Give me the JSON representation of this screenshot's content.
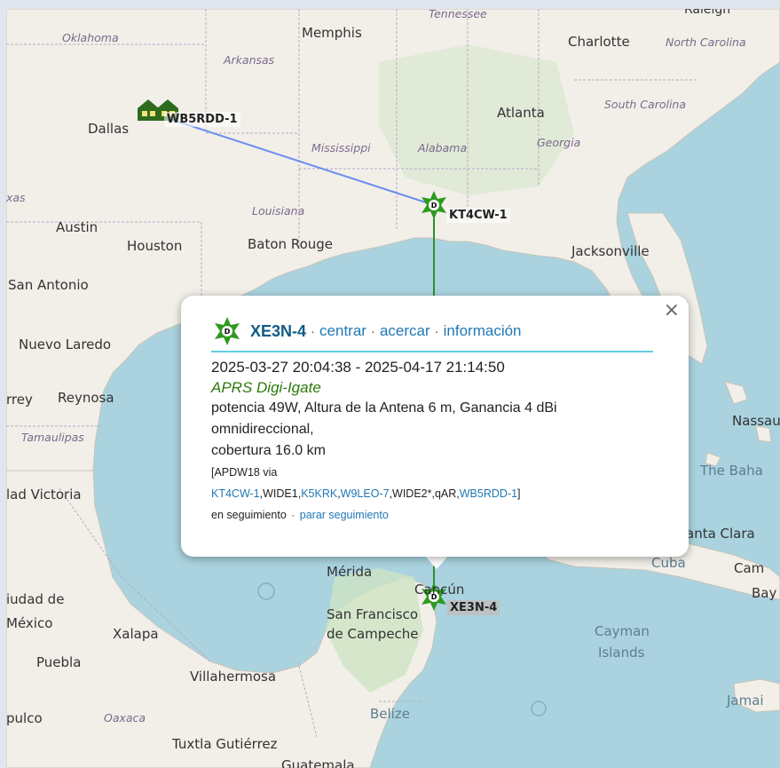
{
  "colors": {
    "water": "#aad3df",
    "land": "#f2efe9",
    "route_blue": "#6b8ff0",
    "route_green": "#2f8f2f",
    "station_green": "#2e9a1e",
    "popup_accent": "#5fd1de"
  },
  "map": {
    "labels": {
      "tennessee": "Tennessee",
      "raleigh": "Raleigh",
      "oklahoma": "Oklahoma",
      "memphis": "Memphis",
      "charlotte": "Charlotte",
      "north_carolina": "North Carolina",
      "arkansas": "Arkansas",
      "south_carolina": "South Carolina",
      "atlanta": "Atlanta",
      "dallas": "Dallas",
      "mississippi": "Mississippi",
      "alabama": "Alabama",
      "georgia": "Georgia",
      "texas": "xas",
      "louisiana": "Louisiana",
      "austin": "Austin",
      "houston": "Houston",
      "baton_rouge": "Baton Rouge",
      "jacksonville": "Jacksonville",
      "san_antonio": "San Antonio",
      "nuevo_laredo": "Nuevo Laredo",
      "monterrey": "rrey",
      "reynosa": "Reynosa",
      "tamaulipas": "Tamaulipas",
      "victoria": "lad Victoria",
      "nassau": "Nassau",
      "bahamas": "The Baha",
      "santa_clara": "anta Clara",
      "cuba": "Cuba",
      "camaguey": "Cam",
      "bayamo": "Bay",
      "merida": "Mérida",
      "cancun": "Cancún",
      "ciudad_mexico": "iudad de",
      "mexico": "México",
      "xalapa": "Xalapa",
      "san_francisco": "San Francisco",
      "campeche": "de Campeche",
      "cayman": "Cayman",
      "islands": "Islands",
      "puebla": "Puebla",
      "villahermosa": "Villahermosa",
      "jamaica": "Jamai",
      "acapulco": "pulco",
      "oaxaca": "Oaxaca",
      "belize": "Belize",
      "tuxtla": "Tuxtla Gutiérrez",
      "guatemala": "Guatemala"
    },
    "stations": {
      "wb5rdd": "WB5RDD-1",
      "kt4cw": "KT4CW-1",
      "xe3n": "XE3N-4"
    }
  },
  "popup": {
    "callsign": "XE3N-4",
    "sep": "·",
    "link_center": "centrar",
    "link_zoom": "acercar",
    "link_info": "información",
    "close": "×",
    "time_range": "2025-03-27 20:04:38 - 2025-04-17 21:14:50",
    "type": "APRS Digi-Igate",
    "phg_line": "potencia 49W, Altura de la Antena 6 m, Ganancia 4 dBi",
    "pattern": "omnidireccional,",
    "coverage": "cobertura 16.0 km",
    "path_prefix": "[APDW18 via",
    "path_1": "KT4CW-1",
    "path_2": ",WIDE1,",
    "path_3": "K5KRK",
    "path_4": ",",
    "path_5": "W9LEO-7",
    "path_6": ",WIDE2*,qAR,",
    "path_7": "WB5RDD-1",
    "path_8": "]",
    "tracking": "en seguimiento",
    "stop_tracking": "parar seguimiento"
  }
}
